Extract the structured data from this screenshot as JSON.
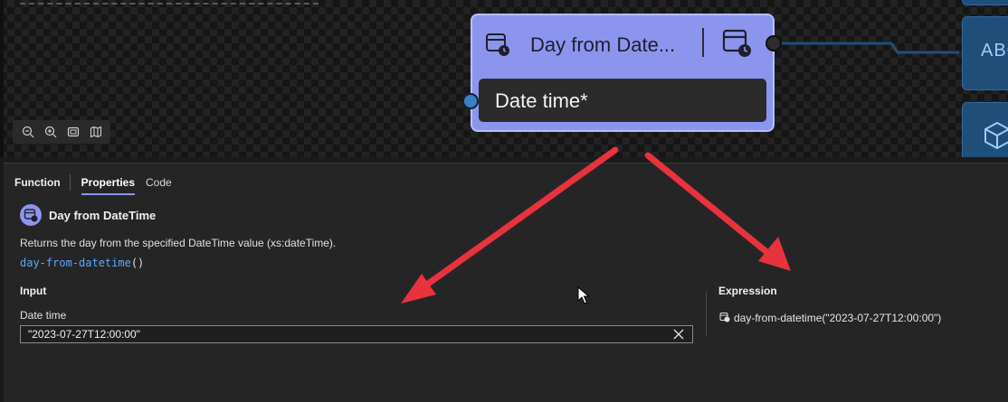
{
  "canvas": {
    "node": {
      "title": "Day from Date...",
      "input_label": "Date time*"
    },
    "side_node_text": "ABC",
    "zoom_toolbar": {
      "buttons": [
        "zoom-out-icon",
        "zoom-in-icon",
        "fit-screen-icon",
        "map-icon"
      ]
    }
  },
  "panel": {
    "tabs": [
      {
        "label": "Function"
      },
      {
        "label": "Properties",
        "active": true
      },
      {
        "label": "Code"
      }
    ],
    "function": {
      "name": "Day from DateTime",
      "description": "Returns the day from the specified DateTime value (xs:dateTime).",
      "signature_name": "day-from-datetime",
      "signature_parens": "()"
    },
    "input": {
      "heading": "Input",
      "field_label": "Date time",
      "field_value": "\"2023-07-27T12:00:00\""
    },
    "expression": {
      "heading": "Expression",
      "text": "day-from-datetime(\"2023-07-27T12:00:00\")"
    }
  },
  "colors": {
    "node_fill": "#8c95ee",
    "accent_blue": "#5aa8ff",
    "arrow_red": "#e8323c"
  }
}
